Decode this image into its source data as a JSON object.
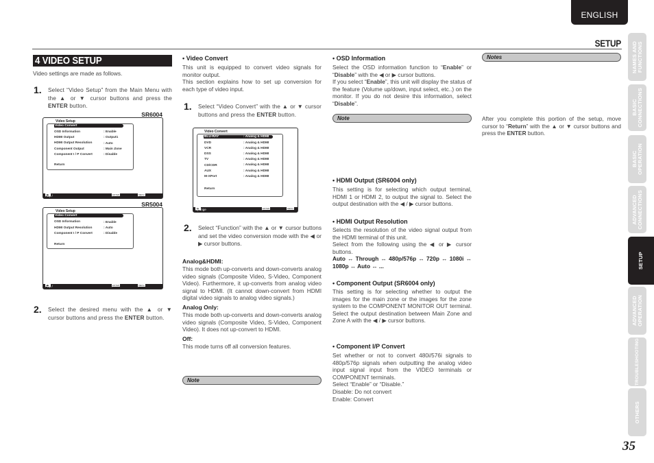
{
  "header": {
    "language": "ENGLISH",
    "chapter": "SETUP"
  },
  "section": {
    "title": "4 VIDEO SETUP",
    "intro": "Video settings are made as follows."
  },
  "left_column": {
    "step1": {
      "num": "1.",
      "text_pre": "Select “Video Setup” from the Main Menu with the ▲ or ▼ cursor buttons and press the ",
      "bold": "ENTER",
      "text_post": " button."
    },
    "screens": [
      {
        "model": "SR6004",
        "title": "Video Setup",
        "rows": [
          {
            "label": "Video Convert",
            "value": "",
            "selected": true
          },
          {
            "label": "OSD Information",
            "value": ": Enable"
          },
          {
            "label": "HDMI Output",
            "value": ": Output1"
          },
          {
            "label": "HDMI Output Resolution",
            "value": ": Auto"
          },
          {
            "label": "Component Output",
            "value": ": Main Zone"
          },
          {
            "label": "Component I / P Convert",
            "value": ": Disable"
          },
          {
            "label": "Return",
            "value": ""
          }
        ],
        "footer": {
          "nav": ": Up / Down",
          "select": ": Select",
          "exit": ": Exit",
          "key_enter": "ENTER",
          "key_menu": "MENU"
        }
      },
      {
        "model": "SR5004",
        "title": "Video Setup",
        "rows": [
          {
            "label": "Video Convert",
            "value": "",
            "selected": true
          },
          {
            "label": "OSD Information",
            "value": ": Enable"
          },
          {
            "label": "HDMI Output Resolution",
            "value": ": Auto"
          },
          {
            "label": "Component I / P Convert",
            "value": ": Disable"
          },
          {
            "label": "Return",
            "value": ""
          }
        ],
        "footer": {
          "nav": ": Up / Down",
          "select": ": Select",
          "exit": ": Exit",
          "key_enter": "ENTER",
          "key_menu": "MENU"
        }
      }
    ],
    "step2": {
      "num": "2.",
      "text_pre": "Select the desired menu with the ▲ or ▼ cursor buttons and press the ",
      "bold": "ENTER",
      "text_post": " button."
    }
  },
  "middle_column": {
    "heading": "• Video Convert",
    "intro1": "This unit is equipped to convert video signals for monitor output.",
    "intro2": "This section explains how to set up conversion for each type of video input.",
    "step1": {
      "num": "1.",
      "text_pre": "Select “Video Convert” with the ▲ or ▼ cursor buttons and press the ",
      "bold": "ENTER",
      "text_post": " button."
    },
    "screen": {
      "title": "Video Convert",
      "rows": [
        {
          "label": "BLU-RAY",
          "value": ": Analog & HDMI",
          "selected": true
        },
        {
          "label": "DVD",
          "value": ": Analog & HDMI"
        },
        {
          "label": "VCR",
          "value": ": Analog & HDMI"
        },
        {
          "label": "DSS",
          "value": ": Analog & HDMI"
        },
        {
          "label": "TV",
          "value": ": Analog & HDMI"
        },
        {
          "label": "CD/CDR",
          "value": ": Analog & HDMI"
        },
        {
          "label": "AUX",
          "value": ": Analog & HDMI"
        },
        {
          "label": "M-XPort",
          "value": ": Analog & HDMI"
        },
        {
          "label": "Return",
          "value": ""
        }
      ],
      "footer": {
        "nav": "Up / Down",
        "change": "Change",
        "exit": ": Exit",
        "key_enter": "ENTER",
        "key_menu": "MENU"
      }
    },
    "step2": {
      "num": "2.",
      "text": "Select “Function” with the ▲ or ▼ cursor buttons and set the video conversion mode with the ◀ or ▶ cursor buttons."
    },
    "modes": [
      {
        "name": "Analog&HDMI:",
        "desc": "This mode both up-converts and down-converts analog video signals (Composite Video, S-Video, Component Video). Furthermore, it up-converts from analog video signal to HDMI. (It cannot down-convert from HDMI digital video signals to analog video signals.)"
      },
      {
        "name": "Analog Only:",
        "desc": "This mode both up-converts and down-converts analog video signals (Composite Video, S-Video, Component Video). It does not up-convert to HDMI."
      },
      {
        "name": "Off:",
        "desc": "This mode turns off all conversion features."
      }
    ],
    "note_label": "Note"
  },
  "right_column": {
    "osd": {
      "heading": "• OSD Information",
      "t1": "Select the OSD information function to “",
      "b1": "Enable",
      "t2": "” or “",
      "b2": "Disable",
      "t3": "” with the ◀ or ▶ cursor buttons.",
      "t4": "If you select “",
      "b3": "Enable",
      "t5": "”, this unit will display the status of the feature (Volume up/down, input select, etc..) on the monitor. If you do not desire this information, select “",
      "b4": "Disable",
      "t6": "”.",
      "note_label": "Note"
    },
    "hdmi_output": {
      "heading": "• HDMI Output (SR6004 only)",
      "desc": "This setting is for selecting which output terminal, HDMI 1 or HDMI 2, to output the signal to. Select the output destination with the ◀ / ▶ cursor buttons."
    },
    "hdmi_resolution": {
      "heading": "• HDMI Output Resolution",
      "desc1": "Selects the resolution of the video signal output from the HDMI terminal of this unit.",
      "desc2": "Select from the following using the ◀ or ▶ cursor buttons.",
      "sequence": "Auto ↔ Through ↔ 480p/576p ↔ 720p ↔ 1080i ↔ 1080p ↔ Auto ↔ ..."
    },
    "component_output": {
      "heading": "• Component Output (SR6004 only)",
      "desc": "This setting is for selecting whether to output the images for the main zone or the images for the zone system to the COMPONENT MONITOR OUT terminal. Select the output destination between Main Zone and Zone A with the ◀ / ▶ cursor buttons."
    },
    "component_ip": {
      "heading": "• Component I/P Convert",
      "desc": "Set whether or not to convert 480i/576i signals to 480p/576p signals when outputting the analog video input signal input from the VIDEO terminals or COMPONENT terminals.",
      "line1": "Select “Enable” or “Disable.”",
      "line2": "Disable: Do not convert",
      "line3": "Enable: Convert"
    }
  },
  "far_right_column": {
    "notes_label": "Notes",
    "t1": "After you complete this portion of the setup, move cursor to “",
    "b1": "Return",
    "t2": "” with the ▲ or ▼ cursor buttons and press the ",
    "b2": "ENTER",
    "t3": " button."
  },
  "side_tabs": [
    {
      "label": "NAMES AND\nFUNCTIONS",
      "active": false
    },
    {
      "label": "BASIC\nCONNECTIONS",
      "active": false
    },
    {
      "label": "BASIC\nOPERATION",
      "active": false
    },
    {
      "label": "ADVANCED\nCONNECTIONS",
      "active": false
    },
    {
      "label": "SETUP",
      "active": true
    },
    {
      "label": "ADVANCED\nOPERATION",
      "active": false
    },
    {
      "label": "TROUBLESHOOTING",
      "active": false
    },
    {
      "label": "OTHERS",
      "active": false
    }
  ],
  "page_number": "35"
}
